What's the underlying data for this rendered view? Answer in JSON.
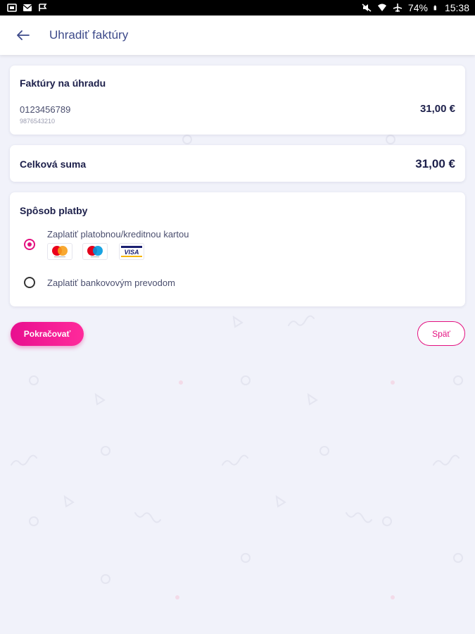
{
  "status_bar": {
    "battery": "74%",
    "time": "15:38"
  },
  "header": {
    "title": "Uhradiť faktúry",
    "back_icon": "arrow-left-icon"
  },
  "invoices": {
    "title": "Faktúry na úhradu",
    "items": [
      {
        "number": "0123456789",
        "sub": "9876543210",
        "amount": "31,00 €"
      }
    ]
  },
  "total": {
    "label": "Celková suma",
    "amount": "31,00 €"
  },
  "payment": {
    "title": "Spôsob platby",
    "options": [
      {
        "label": "Zaplatiť platobnou/kreditnou kartou",
        "selected": true,
        "logos": [
          "mastercard-icon",
          "maestro-icon",
          "visa-icon"
        ]
      },
      {
        "label": "Zaplatiť bankovovým prevodom",
        "selected": false
      }
    ]
  },
  "actions": {
    "continue_label": "Pokračovať",
    "back_label": "Späť"
  },
  "colors": {
    "accent": "#e3107f",
    "title": "#1c1f4a",
    "background": "#f1f2fa"
  }
}
